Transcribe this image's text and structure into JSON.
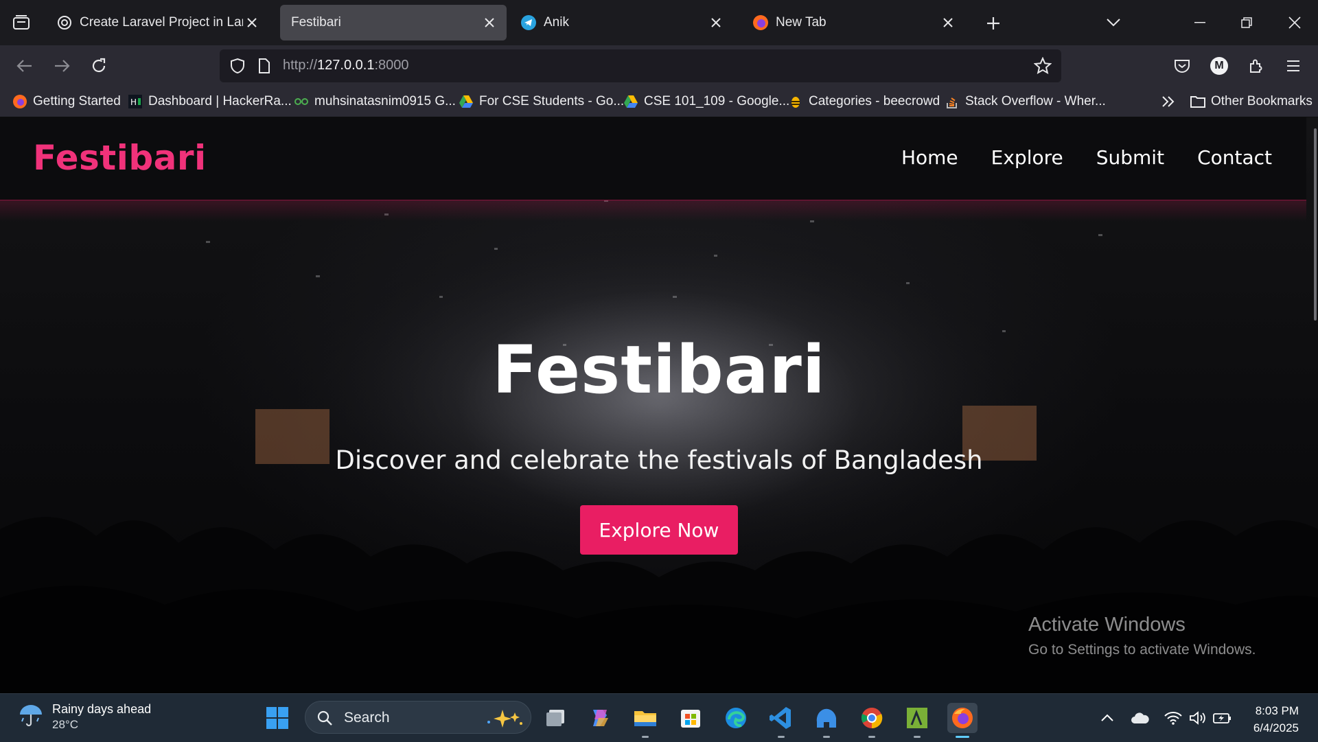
{
  "browser": {
    "tabs": [
      {
        "title": "Create Laravel Project in Larago",
        "active": false,
        "icon": "chatgpt-icon"
      },
      {
        "title": "Festibari",
        "active": true,
        "icon": ""
      },
      {
        "title": "Anik",
        "active": false,
        "icon": "telegram-icon"
      },
      {
        "title": "New Tab",
        "active": false,
        "icon": "firefox-icon"
      }
    ],
    "url_prefix": "http://",
    "url_host": "127.0.0.1",
    "url_port": ":8000",
    "profile_initial": "M",
    "bookmarks": [
      {
        "label": "Getting Started",
        "icon": "firefox-icon"
      },
      {
        "label": "Dashboard | HackerRa...",
        "icon": "hackerrank-icon"
      },
      {
        "label": "muhsinatasnim0915 G...",
        "icon": "codeforces-icon"
      },
      {
        "label": "For CSE Students - Go...",
        "icon": "google-drive-icon"
      },
      {
        "label": "CSE 101_109 - Google...",
        "icon": "google-drive-icon"
      },
      {
        "label": "Categories - beecrowd",
        "icon": "beecrowd-icon"
      },
      {
        "label": "Stack Overflow - Wher...",
        "icon": "stackoverflow-icon"
      }
    ],
    "other_bookmarks": "Other Bookmarks"
  },
  "site": {
    "brand": "Festibari",
    "nav": [
      "Home",
      "Explore",
      "Submit",
      "Contact"
    ],
    "hero_title": "Festibari",
    "hero_subtitle": "Discover and celebrate the festivals of Bangladesh",
    "hero_button": "Explore Now"
  },
  "watermark": {
    "line1": "Activate Windows",
    "line2": "Go to Settings to activate Windows."
  },
  "taskbar": {
    "weather_title": "Rainy days ahead",
    "weather_temp": "28°C",
    "search_placeholder": "Search",
    "time": "8:03 PM",
    "date": "6/4/2025"
  },
  "colors": {
    "accent": "#e91e63",
    "brand": "#f0327a",
    "active_tab": "#46464c"
  }
}
